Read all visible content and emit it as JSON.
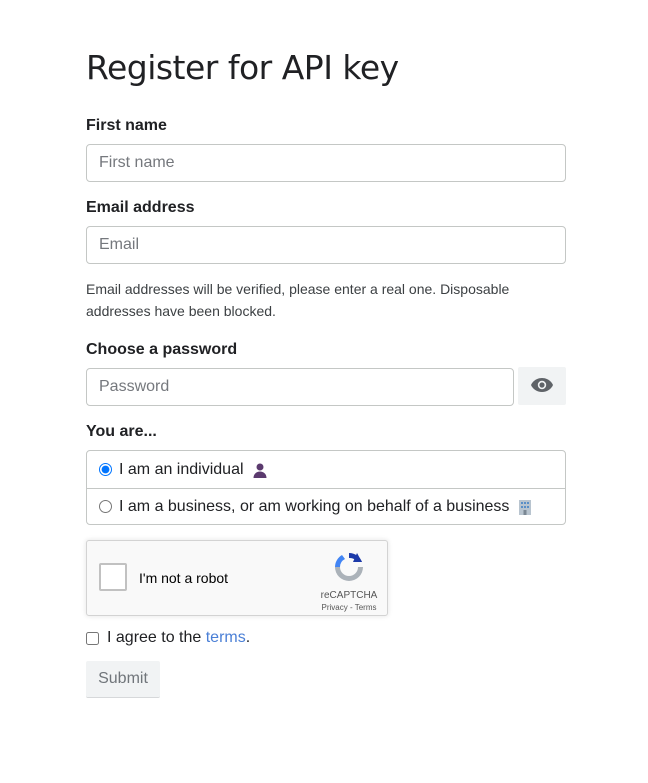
{
  "page": {
    "title": "Register for API key"
  },
  "form": {
    "first_name": {
      "label": "First name",
      "placeholder": "First name",
      "value": ""
    },
    "email": {
      "label": "Email address",
      "placeholder": "Email",
      "value": "",
      "help": "Email addresses will be verified, please enter a real one. Disposable addresses have been blocked."
    },
    "password": {
      "label": "Choose a password",
      "placeholder": "Password",
      "value": "",
      "toggle_icon": "eye-icon"
    },
    "you_are": {
      "label": "You are...",
      "options": [
        {
          "label": "I am an individual",
          "icon": "person-icon",
          "selected": true
        },
        {
          "label": "I am a business, or am working on behalf of a business",
          "icon": "office-building-icon",
          "selected": false
        }
      ]
    },
    "captcha": {
      "text": "I'm not a robot",
      "brand": "reCAPTCHA",
      "privacy": "Privacy",
      "separator": " - ",
      "terms": "Terms",
      "checked": false
    },
    "agree": {
      "prefix": "I agree to the ",
      "link": "terms",
      "suffix": ".",
      "checked": false
    },
    "submit_label": "Submit"
  },
  "colors": {
    "accent": "#1a73e8",
    "link": "#4a7fd6",
    "border": "#c4c7c5",
    "button_bg": "#f1f3f4"
  }
}
